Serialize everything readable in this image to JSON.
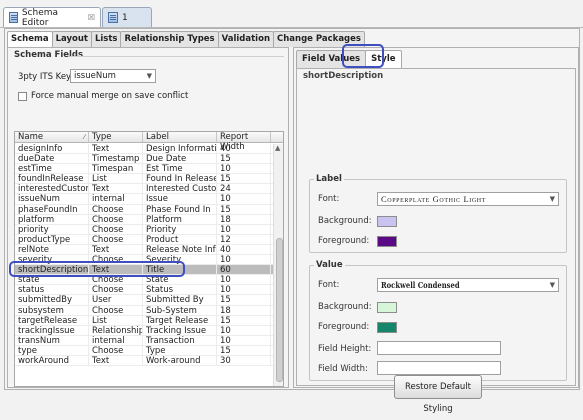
{
  "editor_tabs": {
    "active": {
      "label": "Schema Editor",
      "close": "☒"
    },
    "inactive": {
      "label": "1"
    }
  },
  "schema_tabs": [
    "Schema",
    "Layout",
    "Lists",
    "Relationship Types",
    "Validation",
    "Change Packages"
  ],
  "schema_fields": {
    "title": "Schema Fields",
    "its_key_label": "3pty ITS Key:",
    "its_key_value": "issueNum",
    "force_merge_label": "Force manual merge on save conflict",
    "columns": [
      "Name",
      "Type",
      "Label",
      "Report Width"
    ],
    "rows": [
      [
        "designInfo",
        "Text",
        "Design Information",
        "40"
      ],
      [
        "dueDate",
        "Timestamp",
        "Due Date",
        "15"
      ],
      [
        "estTime",
        "Timespan",
        "Est Time",
        "10"
      ],
      [
        "foundInRelease",
        "List",
        "Found In Release",
        "15"
      ],
      [
        "interestedCustomer",
        "Text",
        "Interested Custom...",
        "24"
      ],
      [
        "issueNum",
        "internal",
        "Issue",
        "10"
      ],
      [
        "phaseFoundIn",
        "Choose",
        "Phase Found In",
        "15"
      ],
      [
        "platform",
        "Choose",
        "Platform",
        "18"
      ],
      [
        "priority",
        "Choose",
        "Priority",
        "10"
      ],
      [
        "productType",
        "Choose",
        "Product",
        "12"
      ],
      [
        "relNote",
        "Text",
        "Release Note Info",
        "40"
      ],
      [
        "severity",
        "Choose",
        "Severity",
        "10"
      ],
      [
        "shortDescription",
        "Text",
        "Title",
        "60"
      ],
      [
        "state",
        "Choose",
        "State",
        "10"
      ],
      [
        "status",
        "Choose",
        "Status",
        "10"
      ],
      [
        "submittedBy",
        "User",
        "Submitted By",
        "15"
      ],
      [
        "subsystem",
        "Choose",
        "Sub-System",
        "18"
      ],
      [
        "targetRelease",
        "List",
        "Target Release",
        "15"
      ],
      [
        "trackingIssue",
        "Relationship",
        "Tracking Issue",
        "10"
      ],
      [
        "transNum",
        "internal",
        "Transaction",
        "10"
      ],
      [
        "type",
        "Choose",
        "Type",
        "15"
      ],
      [
        "workAround",
        "Text",
        "Work-around",
        "30"
      ]
    ],
    "selected_row": "shortDescription"
  },
  "right": {
    "tabs": [
      "Field Values",
      "Style"
    ],
    "field_name": "shortDescription",
    "label_group": {
      "title": "Label",
      "font_label": "Font:",
      "font_value": "Copperplate Gothic Light",
      "background_label": "Background:",
      "background_color": "#c9c4ef",
      "foreground_label": "Foreground:",
      "foreground_color": "#5b0a86"
    },
    "value_group": {
      "title": "Value",
      "font_label": "Font:",
      "font_value": "Rockwell Condensed",
      "background_label": "Background:",
      "background_color": "#d6f5d9",
      "foreground_label": "Foreground:",
      "foreground_color": "#16866b",
      "field_height_label": "Field Height:",
      "field_width_label": "Field Width:"
    },
    "restore_button": "Restore Default Styling"
  }
}
